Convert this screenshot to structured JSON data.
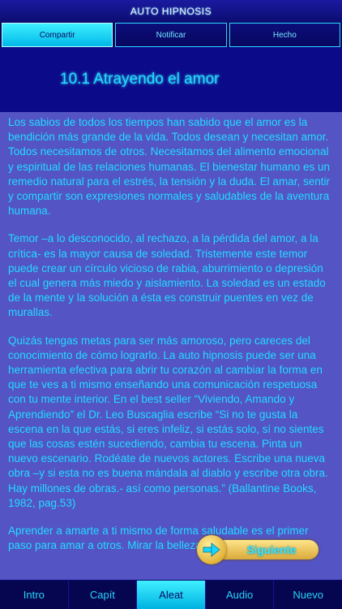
{
  "window": {
    "title": "AUTO HIPNOSIS"
  },
  "tabs": [
    {
      "label": "Compartir",
      "active": true
    },
    {
      "label": "Notificar",
      "active": false
    },
    {
      "label": "Hecho",
      "active": false
    }
  ],
  "main": {
    "title": "10.1 Atrayendo el amor",
    "paragraphs": [
      "Los sabios de todos los tiempos han sabido que el amor es la bendición más grande de la vida. Todos desean y necesitan amor. Todos necesitamos de otros. Necesitamos del alimento emocional y espiritual de las relaciones humanas. El bienestar humano es un remedio natural para el estrés, la tensión y la duda. El amar, sentir y compartir son expresiones normales y saludables de la aventura humana.",
      "Temor –a lo desconocido, al rechazo, a la pérdida del amor, a la crítica- es la mayor causa de soledad. Tristemente este temor puede crear un círculo vicioso de rabia, aburrimiento o depresión el cual genera más miedo y aislamiento. La soledad es un estado de la mente y la solución a ésta es construir puentes en vez de murallas.",
      "Quizás tengas metas para ser más amoroso, pero careces del conocimiento de cómo lograrlo. La auto hipnosis puede ser una herramienta efectiva para abrir tu corazón al cambiar la forma en que te ves a ti mismo enseñando una comunicación respetuosa con tu mente interior. En el best seller “Viviendo, Amando y Aprendiendo” el Dr. Leo Buscaglia escribe “Si no te gusta la escena en la que estás, si eres infeliz, si estás solo, sí no sientes que las cosas estén sucediendo, cambia tu escena. Pinta un nuevo escenario. Rodéate de nuevos actores. Escribe una nueva obra –y si esta no es buena mándala al diablo y escribe otra obra. Hay millones de obras.- así como personas.” (Ballantine Books, 1982, pag.53)",
      "Aprender a amarte a ti mismo de forma saludable es el primer paso para amar a otros. Mirar la belleza en ti es tan necesario"
    ]
  },
  "next_button": {
    "label": "Siguiente",
    "icon": "arrow-right-icon"
  },
  "bottom_nav": [
    {
      "label": "Intro",
      "active": false
    },
    {
      "label": "Capít",
      "active": false
    },
    {
      "label": "Aleat",
      "active": true
    },
    {
      "label": "Audio",
      "active": false
    },
    {
      "label": "Nuevo",
      "active": false
    }
  ],
  "colors": {
    "accent": "#22dcff",
    "header_bg": "#0d0d93",
    "article_bg": "#5454c4",
    "button_gold": "#e2b33a"
  }
}
